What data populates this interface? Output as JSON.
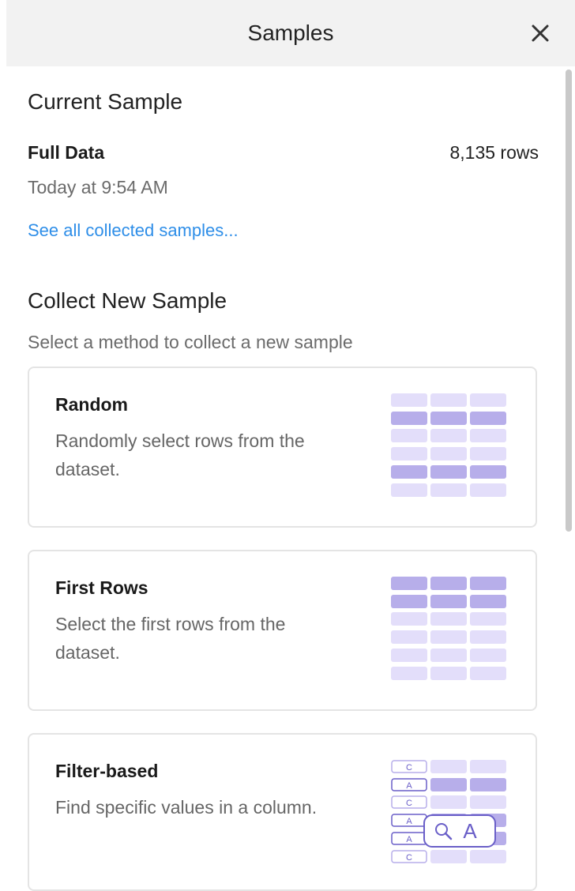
{
  "header": {
    "title": "Samples"
  },
  "current": {
    "heading": "Current Sample",
    "name": "Full Data",
    "rows": "8,135 rows",
    "time": "Today at 9:54 AM",
    "link": "See all collected samples..."
  },
  "collect": {
    "heading": "Collect New Sample",
    "subtitle": "Select a method to collect a new sample"
  },
  "cards": [
    {
      "title": "Random",
      "desc": "Randomly select rows from the dataset."
    },
    {
      "title": "First Rows",
      "desc": "Select the first rows from the dataset."
    },
    {
      "title": "Filter-based",
      "desc": "Find specific values in a column."
    }
  ],
  "filter_icon": {
    "row_letters": [
      "C",
      "A",
      "C",
      "A",
      "A",
      "C"
    ],
    "search_letter": "A"
  },
  "colors": {
    "accent": "#2e8ee8",
    "cell_light": "#e3defa",
    "cell_dark": "#b7aeea"
  }
}
